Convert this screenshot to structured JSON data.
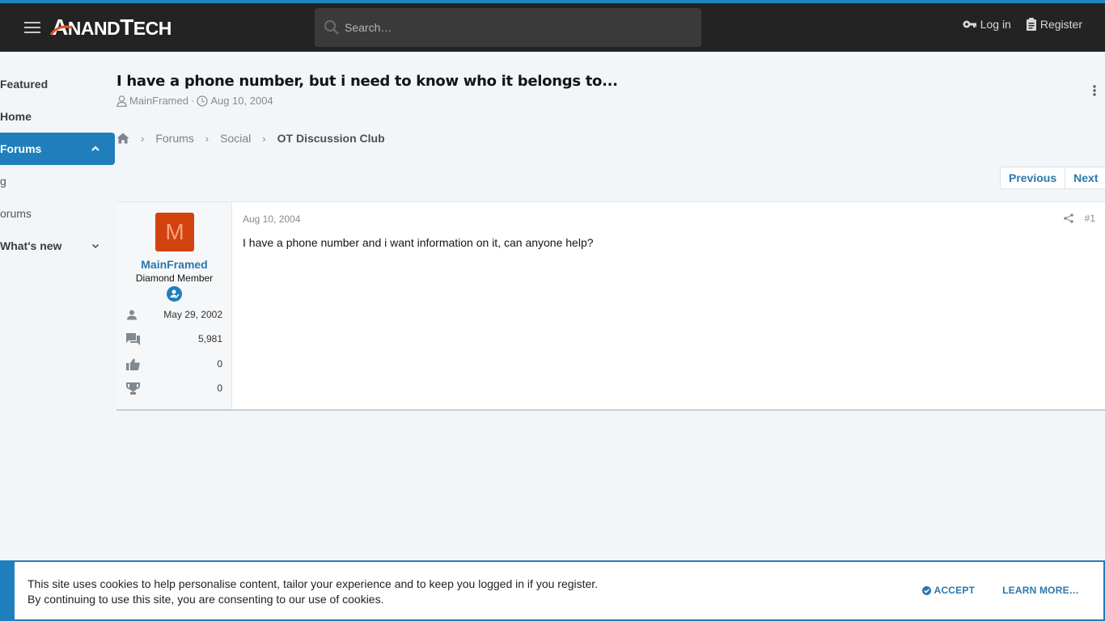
{
  "header": {
    "logo": {
      "big": "A",
      "rest_big": "NAND",
      "t": "T",
      "rest": "ECH",
      "alt": "AnandTech"
    },
    "search": {
      "placeholder": "Search…"
    },
    "login_label": "Log in",
    "register_label": "Register"
  },
  "sidebar": {
    "items": [
      {
        "label": "Featured"
      },
      {
        "label": "Home"
      },
      {
        "label": "Forums"
      },
      {
        "label": "g"
      },
      {
        "label": "orums"
      },
      {
        "label": "What's new"
      }
    ]
  },
  "thread": {
    "title": "I have a phone number, but i need to know who it belongs to...",
    "author": "MainFramed",
    "meta_sep": "·",
    "date": "Aug 10, 2004"
  },
  "breadcrumb": {
    "items": [
      {
        "label": "Forums"
      },
      {
        "label": "Social"
      },
      {
        "label": "OT Discussion Club"
      }
    ]
  },
  "pager": {
    "previous": "Previous",
    "next": "Next"
  },
  "post": {
    "avatar_letter": "M",
    "username": "MainFramed",
    "user_title": "Diamond Member",
    "stats": {
      "joined": "May 29, 2002",
      "messages": "5,981",
      "reactions": "0",
      "points": "0"
    },
    "date": "Aug 10, 2004",
    "number": "#1",
    "body": "I have a phone number and i want information on it, can anyone help?"
  },
  "cookie": {
    "line1": "This site uses cookies to help personalise content, tailor your experience and to keep you logged in if you register.",
    "line2": "By continuing to use this site, you are consenting to our use of cookies.",
    "accept": "ACCEPT",
    "learn_more": "LEARN MORE…"
  },
  "colors": {
    "accent": "#1f7fbd",
    "header_bg": "#232323",
    "link": "#2b77ae",
    "avatar_bg": "#d2420f"
  }
}
